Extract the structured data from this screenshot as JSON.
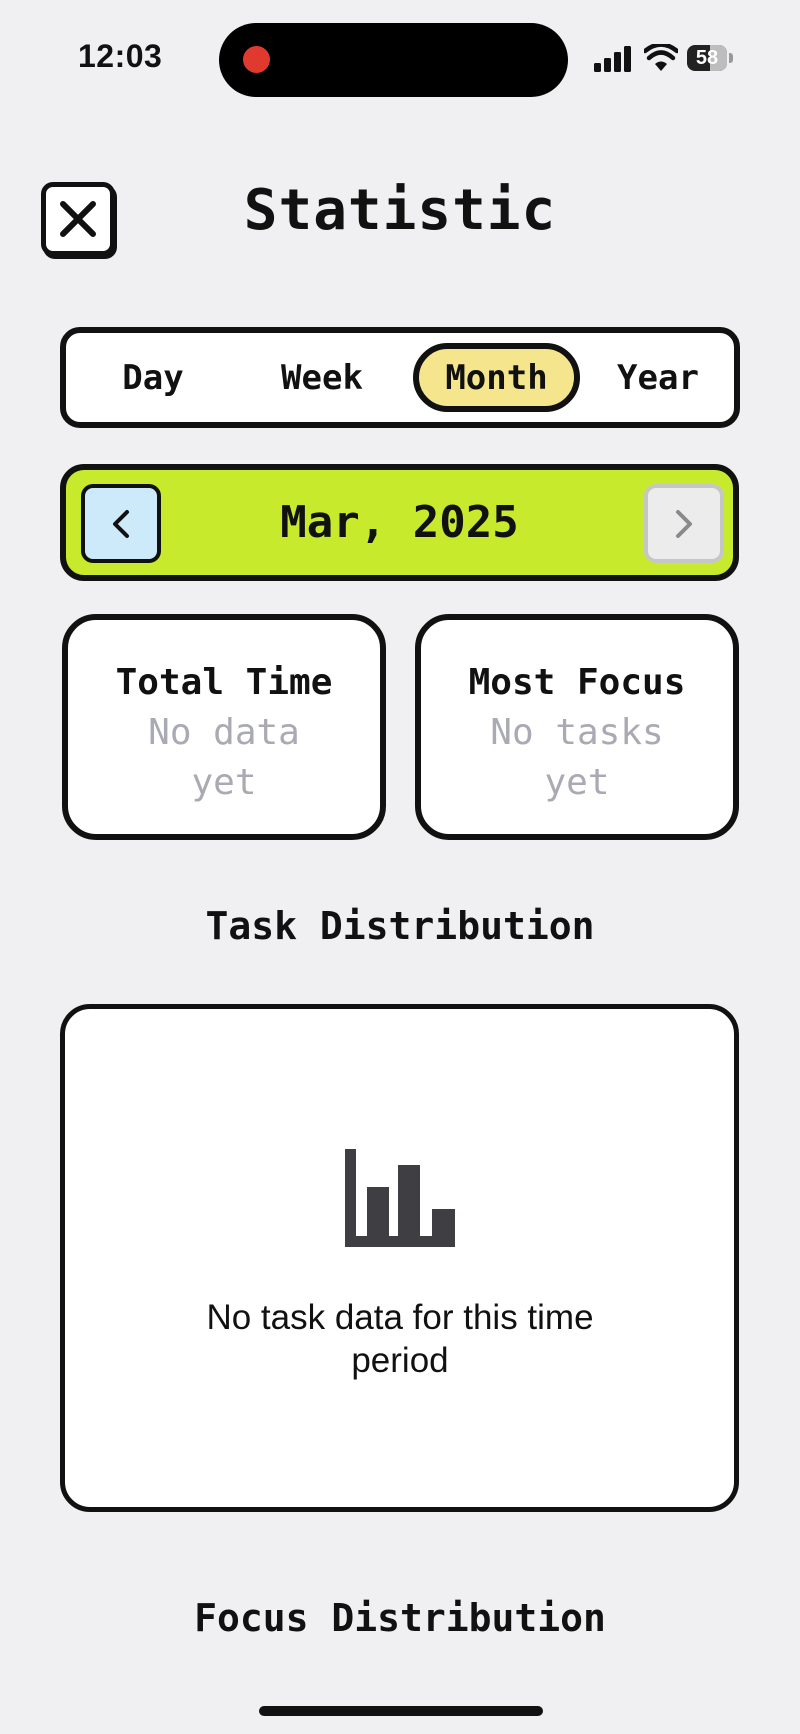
{
  "status_bar": {
    "time": "12:03",
    "battery_level": "58",
    "battery_fraction": 0.58
  },
  "header": {
    "title": "Statistic",
    "close_icon": "close-x-icon"
  },
  "period_tabs": {
    "items": [
      {
        "label": "Day"
      },
      {
        "label": "Week"
      },
      {
        "label": "Month"
      },
      {
        "label": "Year"
      }
    ],
    "selected": "Month"
  },
  "date_nav": {
    "label": "Mar, 2025",
    "prev_icon": "chevron-left-icon",
    "next_icon": "chevron-right-icon"
  },
  "cards": {
    "total_time": {
      "title": "Total Time",
      "value": "No data yet"
    },
    "most_focus": {
      "title": "Most Focus",
      "value": "No tasks yet"
    }
  },
  "task_distribution": {
    "title": "Task Distribution",
    "empty_icon": "bar-chart-icon",
    "empty_message": "No task data for this time period"
  },
  "focus_distribution": {
    "title": "Focus Distribution"
  },
  "colors": {
    "background": "#f0f0f3",
    "active_tab": "#f5e58c",
    "date_nav": "#c8ea2c",
    "prev_button": "#cdeafb",
    "muted_text": "#a9aab3"
  }
}
